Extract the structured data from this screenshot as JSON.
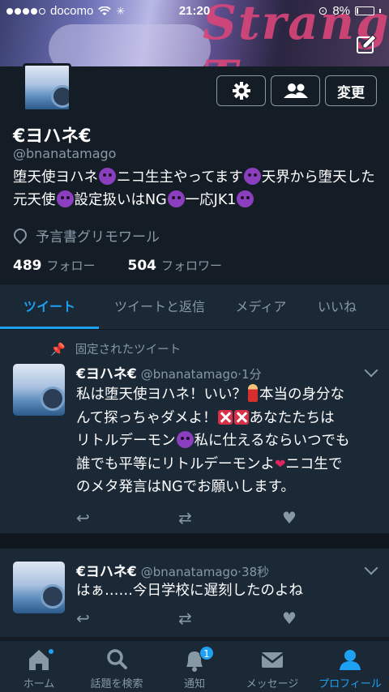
{
  "status_bar": {
    "carrier": "docomo",
    "time": "21:20",
    "battery": "8%"
  },
  "profile": {
    "name": "€ヨハネ€",
    "handle": "@bnanatamago",
    "bio": [
      {
        "t": "text",
        "v": "堕天使ヨハネ"
      },
      {
        "t": "emoji",
        "v": "devil"
      },
      {
        "t": "text",
        "v": "ニコ生主やってます"
      },
      {
        "t": "emoji",
        "v": "devil"
      },
      {
        "t": "text",
        "v": "天界から堕天した元天使"
      },
      {
        "t": "emoji",
        "v": "devil"
      },
      {
        "t": "text",
        "v": "設定扱いはNG"
      },
      {
        "t": "emoji",
        "v": "devil"
      },
      {
        "t": "text",
        "v": "一応JK1"
      },
      {
        "t": "emoji",
        "v": "devil"
      }
    ],
    "location": "予言書グリモワール",
    "following_count": "489",
    "following_label": "フォロー",
    "followers_count": "504",
    "followers_label": "フォロワー",
    "edit_label": "変更"
  },
  "tabs": [
    {
      "label": "ツイート",
      "active": true
    },
    {
      "label": "ツイートと返信",
      "active": false
    },
    {
      "label": "メディア",
      "active": false
    },
    {
      "label": "いいね",
      "active": false
    }
  ],
  "tweets": [
    {
      "pinned_label": "固定されたツイート",
      "name": "€ヨハネ€",
      "handle": "@bnanatamago",
      "time": "1分",
      "text_line1": "私は堕天使ヨハネ！いい？",
      "text_line1b": "本当の身分な",
      "text_line2": "んて探っちゃダメよ！",
      "text_line2b": "あなたたちは",
      "text_line3a": "リトルデーモン",
      "text_line3b": "私に仕えるならいつでも",
      "text_line4": "誰でも平等にリトルデーモンよ",
      "text_line4b": "ニコ生で",
      "text_line5": "のメタ発言はNGでお願いします。"
    },
    {
      "name": "€ヨハネ€",
      "handle": "@bnanatamago",
      "time": "38秒",
      "text": "はぁ……今日学校に遅刻したのよね"
    }
  ],
  "bottom_nav": [
    {
      "label": "ホーム",
      "icon": "home-icon",
      "active": false,
      "badge": "dot"
    },
    {
      "label": "話題を検索",
      "icon": "search-icon",
      "active": false,
      "badge": ""
    },
    {
      "label": "通知",
      "icon": "bell-icon",
      "active": false,
      "badge": "1"
    },
    {
      "label": "メッセージ",
      "icon": "mail-icon",
      "active": false,
      "badge": ""
    },
    {
      "label": "プロフィール",
      "icon": "person-icon",
      "active": true,
      "badge": ""
    }
  ],
  "colors": {
    "background": "#141d26",
    "panel": "#1b2836",
    "accent": "#1da1f2",
    "muted": "#8899a6"
  }
}
